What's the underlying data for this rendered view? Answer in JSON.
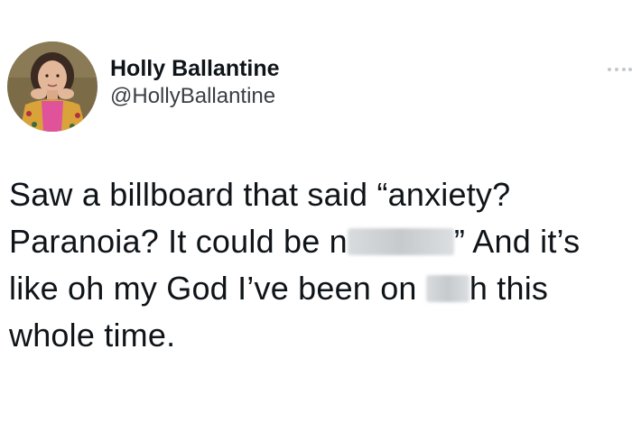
{
  "tweet": {
    "author": {
      "display_name": "Holly Ballantine",
      "handle": "@HollyBallantine",
      "avatar_icon": "profile-photo"
    },
    "more_icon": "more-horizontal-icon",
    "text_lines": [
      "Saw a billboard that said “anxiety?",
      "Paranoia? It could be n",
      "” And it’s",
      "like oh my God I’ve been on ",
      "h this",
      "whole time."
    ],
    "colors": {
      "text": "#0f1419",
      "handle": "#3a3f44",
      "background": "#ffffff",
      "avatar_bg": "#7a6a45",
      "cardigan": "#d9a33a",
      "shirt": "#e0529a"
    }
  }
}
